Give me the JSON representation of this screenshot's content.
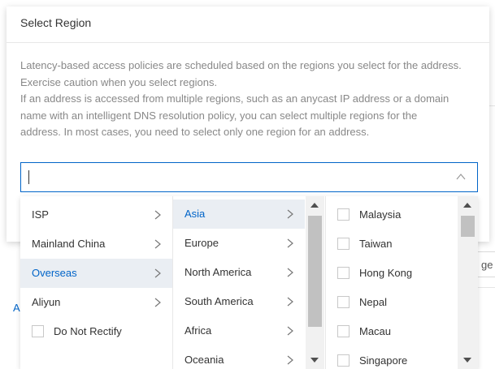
{
  "dialog": {
    "title": "Select Region",
    "description": [
      "Latency-based access policies are scheduled based on the regions you select for the address.",
      "Exercise caution when you select regions.",
      "If an address is accessed from multiple regions, such as an anycast IP address or a domain",
      "name with an intelligent DNS resolution policy, you can select multiple regions for the",
      "address. In most cases, you need to select only one region for an address."
    ]
  },
  "select": {
    "value": "",
    "icon": "chevron-up-icon"
  },
  "cascader": {
    "level1": [
      {
        "label": "ISP",
        "has_children": true,
        "active": false
      },
      {
        "label": "Mainland China",
        "has_children": true,
        "active": false
      },
      {
        "label": "Overseas",
        "has_children": true,
        "active": true
      },
      {
        "label": "Aliyun",
        "has_children": true,
        "active": false
      },
      {
        "label": "Do Not Rectify",
        "checkbox": true,
        "checked": false
      }
    ],
    "level2": [
      {
        "label": "Asia",
        "active": true
      },
      {
        "label": "Europe",
        "active": false
      },
      {
        "label": "North America",
        "active": false
      },
      {
        "label": "South America",
        "active": false
      },
      {
        "label": "Africa",
        "active": false
      },
      {
        "label": "Oceania",
        "active": false
      }
    ],
    "level3": [
      {
        "label": "Malaysia",
        "checked": false
      },
      {
        "label": "Taiwan",
        "checked": false
      },
      {
        "label": "Hong Kong",
        "checked": false
      },
      {
        "label": "Nepal",
        "checked": false
      },
      {
        "label": "Macau",
        "checked": false
      },
      {
        "label": "Singapore",
        "checked": false
      }
    ]
  },
  "background": {
    "input_partial": "ge",
    "link_partial": "A"
  },
  "colors": {
    "accent": "#0064c8",
    "active_bg": "#eaeef3",
    "muted_text": "#888888"
  }
}
